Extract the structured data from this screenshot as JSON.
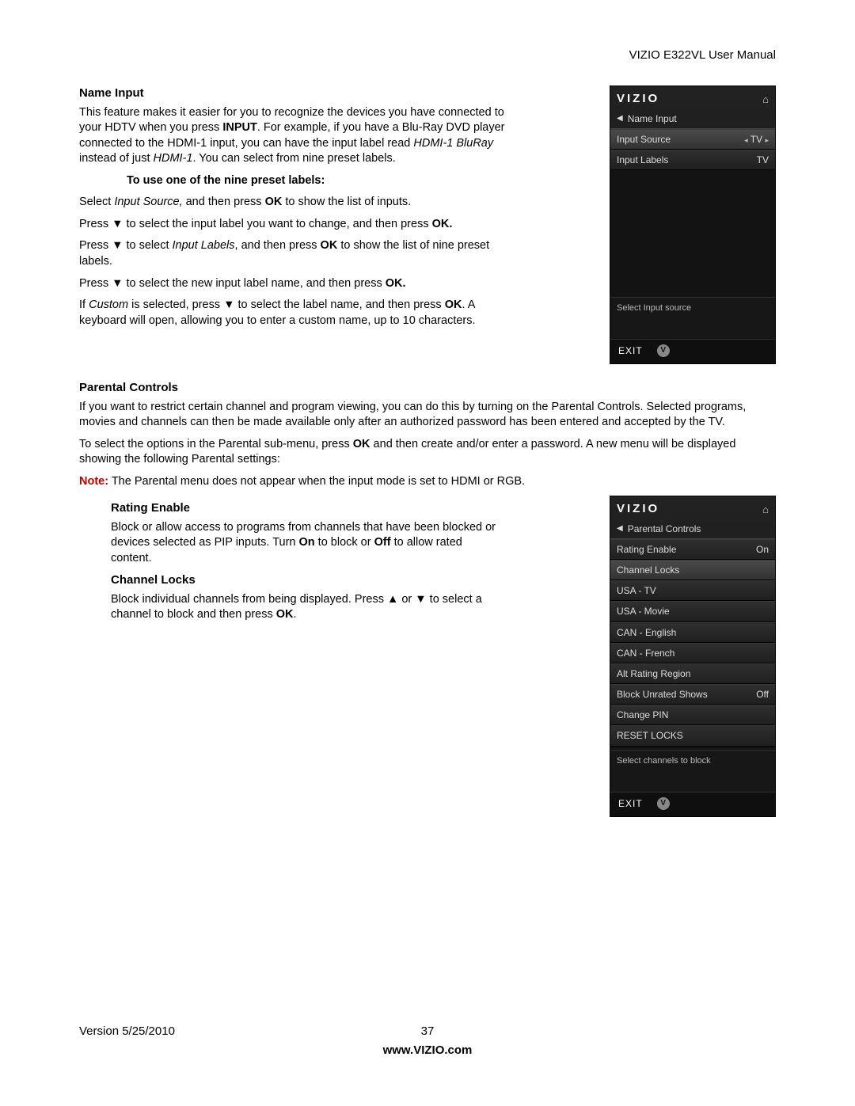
{
  "header": {
    "manual_title": "VIZIO E322VL User Manual"
  },
  "name_input": {
    "heading": "Name Input",
    "intro_pre": "This feature makes it easier for you to recognize the devices you have connected to your HDTV when you press ",
    "intro_bold1": "INPUT",
    "intro_mid": ". For example, if you have a Blu-Ray DVD player connected to the HDMI-1 input, you can have the input label read ",
    "intro_ital1": "HDMI-1 BluRay",
    "intro_mid2": " instead of just ",
    "intro_ital2": "HDMI-1",
    "intro_end": ". You can select from nine preset labels.",
    "preset_heading": "To use one of the nine preset labels:",
    "step1_pre": "Select ",
    "step1_ital": "Input Source,",
    "step1_mid": " and then press ",
    "step1_bold": "OK",
    "step1_end": " to show the list of inputs.",
    "step2_pre": "Press ▼ to select the input label you want to change, and then press ",
    "step2_bold": "OK.",
    "step3_pre": "Press ▼ to select ",
    "step3_ital": "Input Labels",
    "step3_mid": ", and then press ",
    "step3_bold": "OK",
    "step3_end": " to show the list of nine preset labels.",
    "step4_pre": "Press ▼ to select the new input label name, and then press ",
    "step4_bold": "OK.",
    "step5_pre": "If ",
    "step5_ital": "Custom",
    "step5_mid": " is selected, press ▼ to select the label name, and then press ",
    "step5_bold": "OK",
    "step5_end": ". A keyboard will open, allowing you to enter a custom name, up to 10 characters."
  },
  "parental": {
    "heading": "Parental Controls",
    "p1_pre": "If you want to restrict certain channel and program viewing, you can do this by turning on the Parental Controls. Selected programs, movies and channels can then be made available only after an authorized password has been entered and accepted by the TV.",
    "p2_pre": "To select the options in the Parental sub-menu, press ",
    "p2_bold": "OK",
    "p2_end": " and then create and/or enter a password. A new menu will be displayed showing the following Parental settings:",
    "note_label": "Note:",
    "note_text": " The Parental menu does not appear when the input mode is set to HDMI or RGB.",
    "rating_heading": "Rating Enable",
    "rating_pre": "Block or allow access to programs from channels that have been blocked or devices selected as PIP inputs. Turn ",
    "rating_b1": "On",
    "rating_mid": " to block or ",
    "rating_b2": "Off",
    "rating_end": " to allow rated content.",
    "locks_heading": "Channel Locks",
    "locks_pre": "Block individual channels from being displayed. Press ▲ or ▼ to select a channel to block and then press ",
    "locks_bold": "OK",
    "locks_end": "."
  },
  "osd1": {
    "brand": "VIZIO",
    "title": "Name Input",
    "rows": [
      {
        "label": "Input Source",
        "value": "TV",
        "arrows": true,
        "hl": true
      },
      {
        "label": "Input Labels",
        "value": "TV"
      }
    ],
    "help": "Select Input source",
    "exit": "EXIT"
  },
  "osd2": {
    "brand": "VIZIO",
    "title": "Parental Controls",
    "rows": [
      {
        "label": "Rating Enable",
        "value": "On"
      },
      {
        "label": "Channel Locks",
        "hl": true
      },
      {
        "label": "USA - TV"
      },
      {
        "label": "USA - Movie"
      },
      {
        "label": "CAN - English"
      },
      {
        "label": "CAN - French"
      },
      {
        "label": "Alt Rating Region"
      },
      {
        "label": "Block Unrated Shows",
        "value": "Off"
      },
      {
        "label": "Change PIN"
      },
      {
        "label": "RESET LOCKS"
      }
    ],
    "help": "Select channels to block",
    "exit": "EXIT"
  },
  "footer": {
    "version": "Version 5/25/2010",
    "page": "37",
    "url": "www.VIZIO.com"
  }
}
